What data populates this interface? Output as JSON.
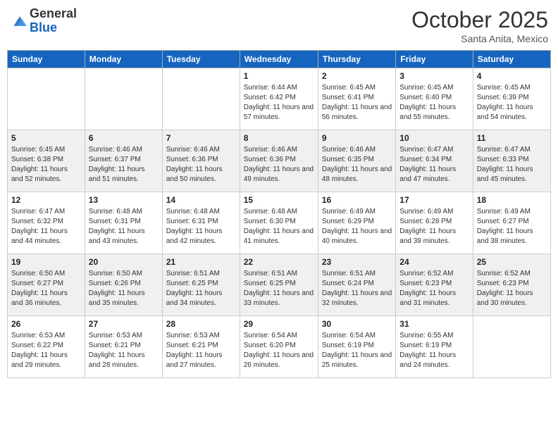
{
  "logo": {
    "general": "General",
    "blue": "Blue"
  },
  "title": {
    "month_year": "October 2025",
    "location": "Santa Anita, Mexico"
  },
  "days": [
    "Sunday",
    "Monday",
    "Tuesday",
    "Wednesday",
    "Thursday",
    "Friday",
    "Saturday"
  ],
  "weeks": [
    [
      {
        "date": "",
        "sunrise": "",
        "sunset": "",
        "daylight": ""
      },
      {
        "date": "",
        "sunrise": "",
        "sunset": "",
        "daylight": ""
      },
      {
        "date": "",
        "sunrise": "",
        "sunset": "",
        "daylight": ""
      },
      {
        "date": "1",
        "sunrise": "Sunrise: 6:44 AM",
        "sunset": "Sunset: 6:42 PM",
        "daylight": "Daylight: 11 hours and 57 minutes."
      },
      {
        "date": "2",
        "sunrise": "Sunrise: 6:45 AM",
        "sunset": "Sunset: 6:41 PM",
        "daylight": "Daylight: 11 hours and 56 minutes."
      },
      {
        "date": "3",
        "sunrise": "Sunrise: 6:45 AM",
        "sunset": "Sunset: 6:40 PM",
        "daylight": "Daylight: 11 hours and 55 minutes."
      },
      {
        "date": "4",
        "sunrise": "Sunrise: 6:45 AM",
        "sunset": "Sunset: 6:39 PM",
        "daylight": "Daylight: 11 hours and 54 minutes."
      }
    ],
    [
      {
        "date": "5",
        "sunrise": "Sunrise: 6:45 AM",
        "sunset": "Sunset: 6:38 PM",
        "daylight": "Daylight: 11 hours and 52 minutes."
      },
      {
        "date": "6",
        "sunrise": "Sunrise: 6:46 AM",
        "sunset": "Sunset: 6:37 PM",
        "daylight": "Daylight: 11 hours and 51 minutes."
      },
      {
        "date": "7",
        "sunrise": "Sunrise: 6:46 AM",
        "sunset": "Sunset: 6:36 PM",
        "daylight": "Daylight: 11 hours and 50 minutes."
      },
      {
        "date": "8",
        "sunrise": "Sunrise: 6:46 AM",
        "sunset": "Sunset: 6:36 PM",
        "daylight": "Daylight: 11 hours and 49 minutes."
      },
      {
        "date": "9",
        "sunrise": "Sunrise: 6:46 AM",
        "sunset": "Sunset: 6:35 PM",
        "daylight": "Daylight: 11 hours and 48 minutes."
      },
      {
        "date": "10",
        "sunrise": "Sunrise: 6:47 AM",
        "sunset": "Sunset: 6:34 PM",
        "daylight": "Daylight: 11 hours and 47 minutes."
      },
      {
        "date": "11",
        "sunrise": "Sunrise: 6:47 AM",
        "sunset": "Sunset: 6:33 PM",
        "daylight": "Daylight: 11 hours and 45 minutes."
      }
    ],
    [
      {
        "date": "12",
        "sunrise": "Sunrise: 6:47 AM",
        "sunset": "Sunset: 6:32 PM",
        "daylight": "Daylight: 11 hours and 44 minutes."
      },
      {
        "date": "13",
        "sunrise": "Sunrise: 6:48 AM",
        "sunset": "Sunset: 6:31 PM",
        "daylight": "Daylight: 11 hours and 43 minutes."
      },
      {
        "date": "14",
        "sunrise": "Sunrise: 6:48 AM",
        "sunset": "Sunset: 6:31 PM",
        "daylight": "Daylight: 11 hours and 42 minutes."
      },
      {
        "date": "15",
        "sunrise": "Sunrise: 6:48 AM",
        "sunset": "Sunset: 6:30 PM",
        "daylight": "Daylight: 11 hours and 41 minutes."
      },
      {
        "date": "16",
        "sunrise": "Sunrise: 6:49 AM",
        "sunset": "Sunset: 6:29 PM",
        "daylight": "Daylight: 11 hours and 40 minutes."
      },
      {
        "date": "17",
        "sunrise": "Sunrise: 6:49 AM",
        "sunset": "Sunset: 6:28 PM",
        "daylight": "Daylight: 11 hours and 39 minutes."
      },
      {
        "date": "18",
        "sunrise": "Sunrise: 6:49 AM",
        "sunset": "Sunset: 6:27 PM",
        "daylight": "Daylight: 11 hours and 38 minutes."
      }
    ],
    [
      {
        "date": "19",
        "sunrise": "Sunrise: 6:50 AM",
        "sunset": "Sunset: 6:27 PM",
        "daylight": "Daylight: 11 hours and 36 minutes."
      },
      {
        "date": "20",
        "sunrise": "Sunrise: 6:50 AM",
        "sunset": "Sunset: 6:26 PM",
        "daylight": "Daylight: 11 hours and 35 minutes."
      },
      {
        "date": "21",
        "sunrise": "Sunrise: 6:51 AM",
        "sunset": "Sunset: 6:25 PM",
        "daylight": "Daylight: 11 hours and 34 minutes."
      },
      {
        "date": "22",
        "sunrise": "Sunrise: 6:51 AM",
        "sunset": "Sunset: 6:25 PM",
        "daylight": "Daylight: 11 hours and 33 minutes."
      },
      {
        "date": "23",
        "sunrise": "Sunrise: 6:51 AM",
        "sunset": "Sunset: 6:24 PM",
        "daylight": "Daylight: 11 hours and 32 minutes."
      },
      {
        "date": "24",
        "sunrise": "Sunrise: 6:52 AM",
        "sunset": "Sunset: 6:23 PM",
        "daylight": "Daylight: 11 hours and 31 minutes."
      },
      {
        "date": "25",
        "sunrise": "Sunrise: 6:52 AM",
        "sunset": "Sunset: 6:23 PM",
        "daylight": "Daylight: 11 hours and 30 minutes."
      }
    ],
    [
      {
        "date": "26",
        "sunrise": "Sunrise: 6:53 AM",
        "sunset": "Sunset: 6:22 PM",
        "daylight": "Daylight: 11 hours and 29 minutes."
      },
      {
        "date": "27",
        "sunrise": "Sunrise: 6:53 AM",
        "sunset": "Sunset: 6:21 PM",
        "daylight": "Daylight: 11 hours and 28 minutes."
      },
      {
        "date": "28",
        "sunrise": "Sunrise: 6:53 AM",
        "sunset": "Sunset: 6:21 PM",
        "daylight": "Daylight: 11 hours and 27 minutes."
      },
      {
        "date": "29",
        "sunrise": "Sunrise: 6:54 AM",
        "sunset": "Sunset: 6:20 PM",
        "daylight": "Daylight: 11 hours and 26 minutes."
      },
      {
        "date": "30",
        "sunrise": "Sunrise: 6:54 AM",
        "sunset": "Sunset: 6:19 PM",
        "daylight": "Daylight: 11 hours and 25 minutes."
      },
      {
        "date": "31",
        "sunrise": "Sunrise: 6:55 AM",
        "sunset": "Sunset: 6:19 PM",
        "daylight": "Daylight: 11 hours and 24 minutes."
      },
      {
        "date": "",
        "sunrise": "",
        "sunset": "",
        "daylight": ""
      }
    ]
  ]
}
